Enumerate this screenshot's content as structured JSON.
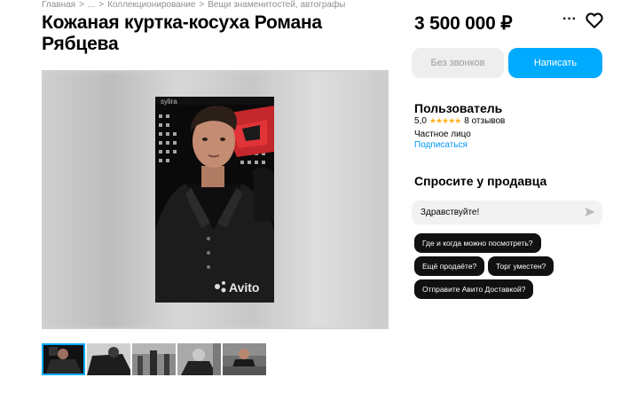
{
  "breadcrumbs": [
    "Главная",
    "...",
    "Коллекционирование",
    "Вещи знаменитостей, автографы"
  ],
  "listing": {
    "title": "Кожаная куртка-косуха Романа Рябцева",
    "price": "3 500 000 ₽"
  },
  "actions": {
    "no_calls_label": "Без звонков",
    "write_label": "Написать",
    "more_icon": "more-horizontal-icon",
    "favorite_icon": "heart-icon"
  },
  "seller": {
    "name": "Пользователь",
    "rating": "5,0",
    "stars": "★★★★★",
    "reviews": "8 отзывов",
    "type": "Частное лицо",
    "subscribe_label": "Подписаться"
  },
  "ask": {
    "title": "Спросите у продавца",
    "message_value": "Здравствуйте!",
    "quick_questions": [
      "Где и когда можно посмотреть?",
      "Ещё продаёте?",
      "Торг уместен?",
      "Отправите Авито Доставкой?"
    ]
  },
  "gallery": {
    "photo_caption_top": "sylira",
    "watermark": "Avito",
    "thumbnail_count": 5,
    "active_thumbnail": 1
  },
  "colors": {
    "accent": "#00aaff",
    "link": "#0099f7",
    "star": "#ffb021",
    "chip_bg": "#111111",
    "muted_btn": "#eeeeee"
  }
}
